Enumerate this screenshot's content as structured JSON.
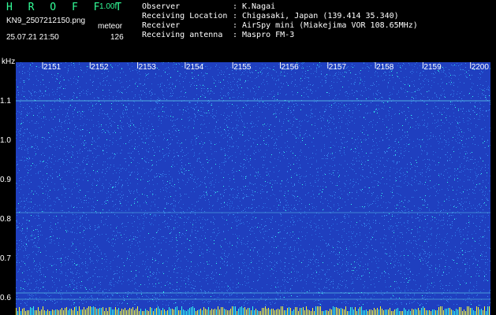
{
  "header": {
    "logo": "H R O F F T",
    "version": "1.00f",
    "filename": "KN9_2507212150.png",
    "mode": "meteor",
    "timestamp": "25.07.21 21:50",
    "count": "126"
  },
  "meta": [
    {
      "key": "Observer",
      "value": "K.Nagai"
    },
    {
      "key": "Receiving Location",
      "value": "Chigasaki, Japan (139.414 35.340)"
    },
    {
      "key": "Receiver",
      "value": "AirSpy mini (Miakejima VOR 108.65MHz)"
    },
    {
      "key": "Receiving antenna",
      "value": "Maspro FM-3"
    }
  ],
  "axis": {
    "y_unit": "kHz",
    "y_ticks": [
      "1.1",
      "1.0",
      "0.9",
      "0.8",
      "0.7",
      "0.6"
    ],
    "x_ticks": [
      "2151",
      "2152",
      "2153",
      "2154",
      "2155",
      "2156",
      "2157",
      "2158",
      "2159",
      "2200"
    ]
  },
  "colors": {
    "background": "#1f3fbf",
    "noise_dim": "#2a6fe0",
    "noise_bright": "#33ffee",
    "accent": "#33ff99",
    "baseline": "#ffff33"
  }
}
